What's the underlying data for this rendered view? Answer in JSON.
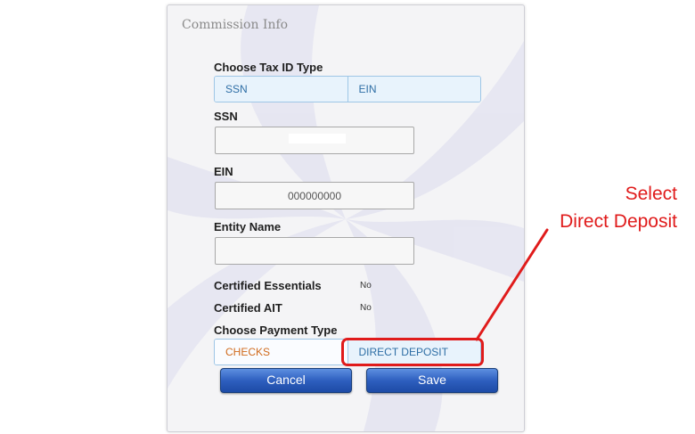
{
  "panel": {
    "title": "Commission Info"
  },
  "tax_id": {
    "label": "Choose Tax ID Type",
    "options": [
      "SSN",
      "EIN"
    ]
  },
  "ssn": {
    "label": "SSN",
    "value": ""
  },
  "ein": {
    "label": "EIN",
    "value": "000000000"
  },
  "entity": {
    "label": "Entity Name",
    "value": ""
  },
  "certified_essentials": {
    "label": "Certified Essentials",
    "value": "No"
  },
  "certified_ait": {
    "label": "Certified AIT",
    "value": "No"
  },
  "payment": {
    "label": "Choose Payment Type",
    "options": [
      "CHECKS",
      "DIRECT DEPOSIT"
    ]
  },
  "buttons": {
    "cancel": "Cancel",
    "save": "Save"
  },
  "annotation": {
    "line1": "Select",
    "line2": "Direct Deposit"
  },
  "colors": {
    "annotation": "#e01b1b",
    "segment_text": "#2e6ea5",
    "checks_text": "#d06a1c",
    "button_blue": "#2e5fbf"
  }
}
